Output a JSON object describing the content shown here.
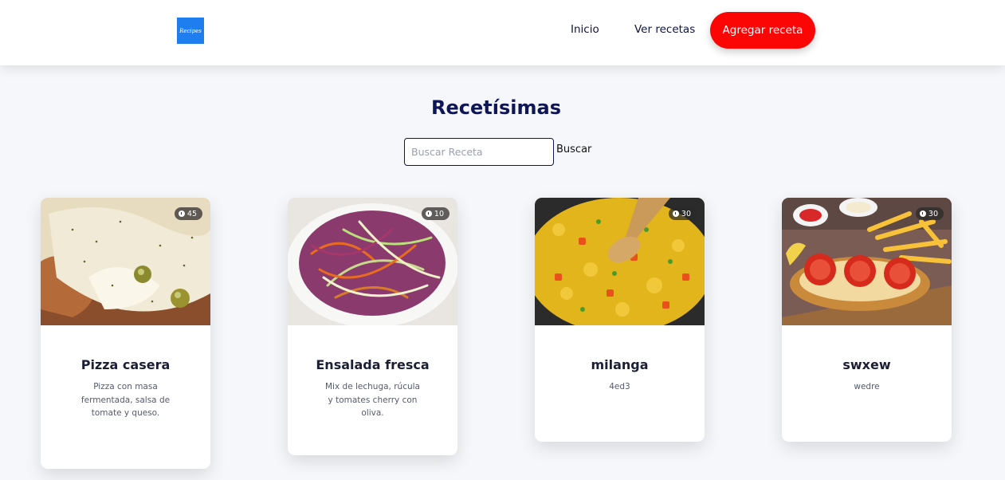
{
  "navbar": {
    "logo_text": "Recipes",
    "links": [
      "Inicio",
      "Ver recetas"
    ],
    "add_button": "Agregar receta"
  },
  "main": {
    "title": "Recetísimas",
    "search": {
      "placeholder": "Buscar Receta",
      "value": "",
      "button": "Buscar"
    }
  },
  "recipes": [
    {
      "title": "Pizza casera",
      "description": "Pizza con masa fermentada, salsa de tomate y queso.",
      "time": "45",
      "image": "pizza-photo"
    },
    {
      "title": "Ensalada fresca",
      "description": "Mix de lechuga, rúcula y tomates cherry con oliva.",
      "time": "10",
      "image": "salad-photo"
    },
    {
      "title": "milanga",
      "description": "4ed3",
      "time": "30",
      "image": "paella-photo"
    },
    {
      "title": "swxew",
      "description": "wedre",
      "time": "30",
      "image": "milanesa-photo"
    }
  ],
  "colors": {
    "accent_red": "#fb0505",
    "title_navy": "#0f1656",
    "logo_blue": "#1e7ef0"
  }
}
